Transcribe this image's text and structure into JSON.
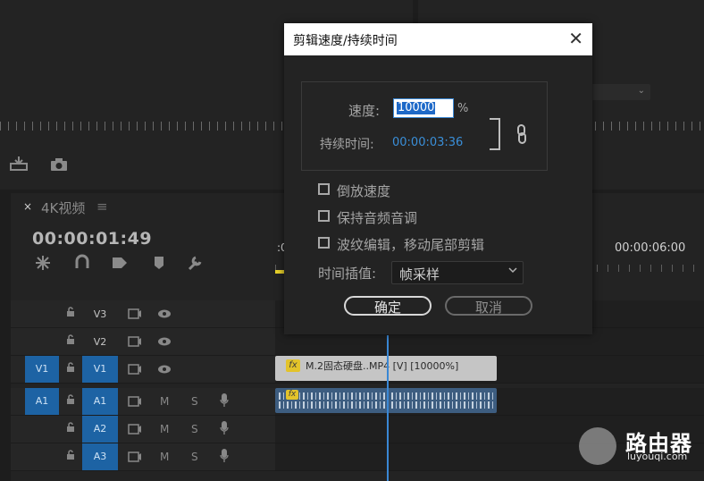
{
  "colors": {
    "accent_blue": "#1d63a4",
    "playhead": "#3a87d4",
    "dialog_bg": "#232323",
    "in_point": "#e7d02a"
  },
  "timeline": {
    "close_glyph": "×",
    "title": "4K视频",
    "menu_glyph": "≡",
    "timecode": "00:00:01:49",
    "ruler_start": ":0",
    "ruler_mark": "00:00:06:00",
    "tracks": [
      {
        "source": "",
        "label": "V3",
        "kind": "video"
      },
      {
        "source": "",
        "label": "V2",
        "kind": "video"
      },
      {
        "source": "V1",
        "label": "V1",
        "kind": "video"
      },
      {
        "source": "A1",
        "label": "A1",
        "kind": "audio",
        "m": "M",
        "s": "S"
      },
      {
        "source": "",
        "label": "A2",
        "kind": "audio",
        "m": "M",
        "s": "S"
      },
      {
        "source": "",
        "label": "A3",
        "kind": "audio",
        "m": "M",
        "s": "S"
      }
    ],
    "clip_video": {
      "fx": "fx",
      "name": "M.2固态硬盘..MP4 [V] [10000%]"
    },
    "clip_audio": {
      "fx": "fx"
    }
  },
  "dialog": {
    "title": "剪辑速度/持续时间",
    "close_glyph": "✕",
    "speed_label": "速度:",
    "speed_value": "10000",
    "speed_unit": "%",
    "duration_label": "持续时间:",
    "duration_value": "00:00:03:36",
    "checkboxes": [
      {
        "label": "倒放速度",
        "checked": false
      },
      {
        "label": "保持音频音调",
        "checked": false
      },
      {
        "label": "波纹编辑，移动尾部剪辑",
        "checked": false
      }
    ],
    "interp_label": "时间插值:",
    "interp_value": "帧采样",
    "ok_label": "确定",
    "cancel_label": "取消"
  },
  "watermark": {
    "main": "路由器",
    "sub": "luyouqi.com"
  }
}
